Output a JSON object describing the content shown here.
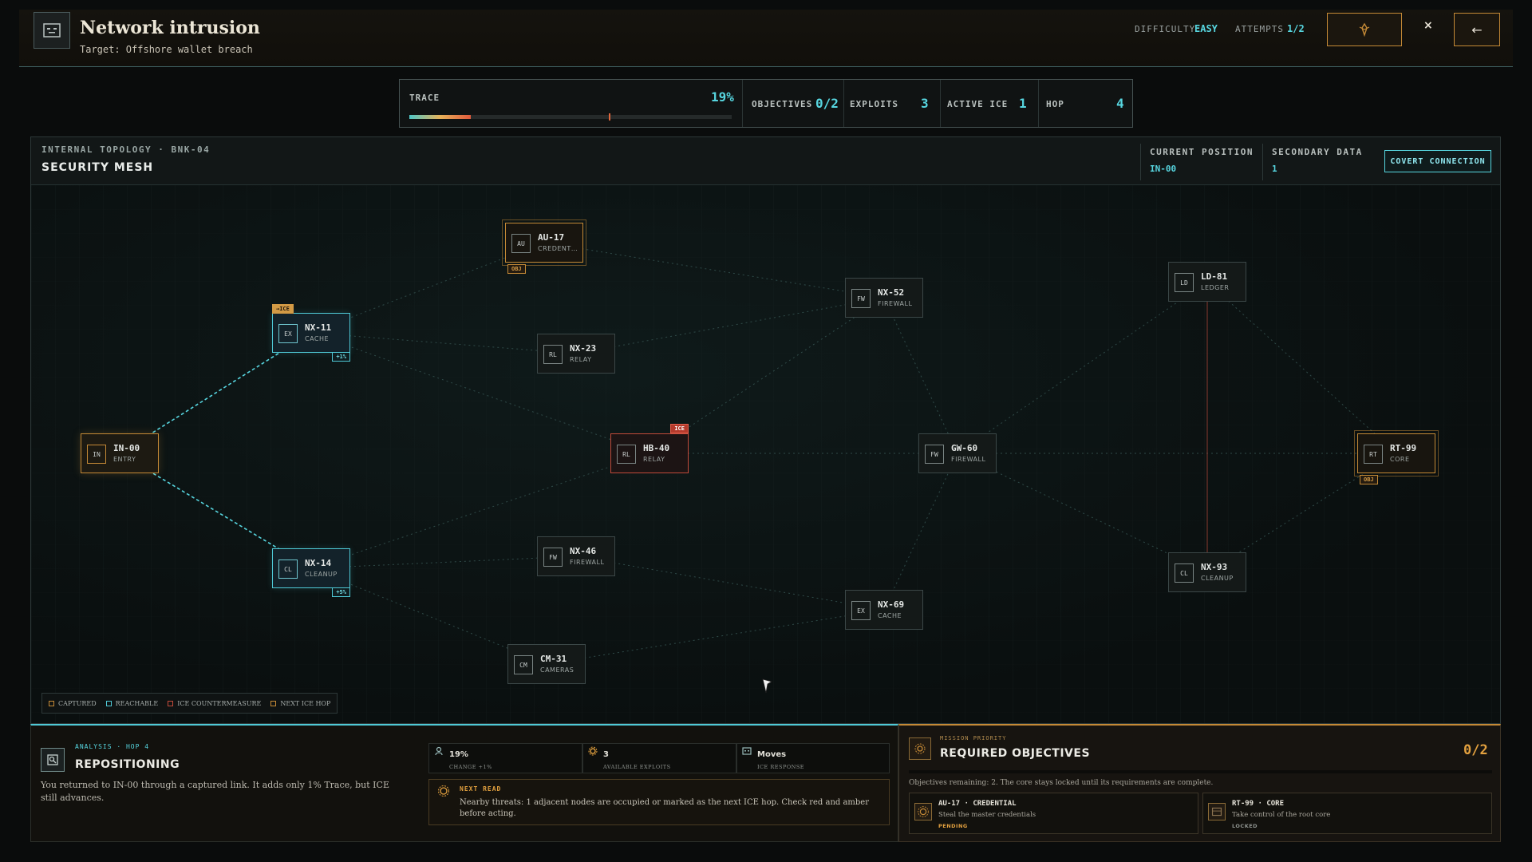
{
  "header": {
    "title": "Network intrusion",
    "subtitle": "Target: Offshore wallet breach",
    "difficulty_label": "DIFFICULTY",
    "difficulty_value": "EASY",
    "attempts_label": "ATTEMPTS",
    "attempts_value": "1/2",
    "close_symbol": "×",
    "back_symbol": "←"
  },
  "stats": {
    "trace_label": "TRACE",
    "trace_value": "19%",
    "trace_fraction": 0.19,
    "trace_threshold_fraction": 0.62,
    "objectives_label": "OBJECTIVES",
    "objectives_value": "0/2",
    "exploits_label": "EXPLOITS",
    "exploits_value": "3",
    "active_ice_label": "ACTIVE ICE",
    "active_ice_value": "1",
    "hop_label": "HOP",
    "hop_value": "4"
  },
  "topology": {
    "kicker": "INTERNAL TOPOLOGY · BNK-04",
    "title": "SECURITY MESH",
    "current_position_label": "CURRENT POSITION",
    "current_position_value": "IN-00",
    "secondary_data_label": "SECONDARY DATA",
    "secondary_data_value": "1",
    "covert_button": "COVERT CONNECTION",
    "nodes": [
      {
        "id": "IN-00",
        "icon": "IN",
        "type": "ENTRY",
        "state": "captured"
      },
      {
        "id": "NX-11",
        "icon": "EX",
        "type": "CACHE",
        "state": "reachable",
        "tag_top": "→ICE",
        "tag_bottom": "+1%"
      },
      {
        "id": "NX-14",
        "icon": "CL",
        "type": "CLEANUP",
        "state": "reachable",
        "tag_bottom": "+5%"
      },
      {
        "id": "AU-17",
        "icon": "AU",
        "type": "CREDENT…",
        "state": "obj",
        "tag_bottom": "OBJ"
      },
      {
        "id": "NX-23",
        "icon": "RL",
        "type": "RELAY",
        "state": "idle"
      },
      {
        "id": "HB-40",
        "icon": "RL",
        "type": "RELAY",
        "state": "ice",
        "tag_top": "ICE"
      },
      {
        "id": "NX-46",
        "icon": "FW",
        "type": "FIREWALL",
        "state": "idle"
      },
      {
        "id": "CM-31",
        "icon": "CM",
        "type": "CAMERAS",
        "state": "idle"
      },
      {
        "id": "NX-52",
        "icon": "FW",
        "type": "FIREWALL",
        "state": "idle"
      },
      {
        "id": "GW-60",
        "icon": "FW",
        "type": "FIREWALL",
        "state": "idle"
      },
      {
        "id": "NX-69",
        "icon": "EX",
        "type": "CACHE",
        "state": "idle"
      },
      {
        "id": "LD-81",
        "icon": "LD",
        "type": "LEDGER",
        "state": "idle"
      },
      {
        "id": "NX-93",
        "icon": "CL",
        "type": "CLEANUP",
        "state": "idle"
      },
      {
        "id": "RT-99",
        "icon": "RT",
        "type": "CORE",
        "state": "obj",
        "tag_bottom": "OBJ"
      }
    ],
    "links": [
      [
        "IN-00",
        "NX-11",
        "captured"
      ],
      [
        "IN-00",
        "NX-14",
        "captured"
      ],
      [
        "NX-11",
        "AU-17",
        "dim"
      ],
      [
        "NX-11",
        "NX-23",
        "dim"
      ],
      [
        "NX-11",
        "HB-40",
        "dim"
      ],
      [
        "NX-14",
        "HB-40",
        "dim"
      ],
      [
        "NX-14",
        "NX-46",
        "dim"
      ],
      [
        "NX-14",
        "CM-31",
        "dim"
      ],
      [
        "AU-17",
        "NX-52",
        "dim"
      ],
      [
        "NX-23",
        "NX-52",
        "dim"
      ],
      [
        "HB-40",
        "GW-60",
        "dim"
      ],
      [
        "HB-40",
        "NX-52",
        "dim"
      ],
      [
        "NX-46",
        "NX-69",
        "dim"
      ],
      [
        "CM-31",
        "NX-69",
        "dim"
      ],
      [
        "NX-52",
        "GW-60",
        "dim"
      ],
      [
        "GW-60",
        "LD-81",
        "dim"
      ],
      [
        "GW-60",
        "RT-99",
        "dim"
      ],
      [
        "GW-60",
        "NX-93",
        "dim"
      ],
      [
        "NX-69",
        "GW-60",
        "dim"
      ],
      [
        "LD-81",
        "RT-99",
        "dim"
      ],
      [
        "LD-81",
        "NX-93",
        "ice"
      ],
      [
        "NX-93",
        "RT-99",
        "dim"
      ]
    ],
    "legend": [
      {
        "label": "CAPTURED",
        "color": "#c58a36"
      },
      {
        "label": "REACHABLE",
        "color": "#4fc9d6"
      },
      {
        "label": "ICE COUNTERMEASURE",
        "color": "#c24a3a"
      },
      {
        "label": "NEXT ICE HOP",
        "color": "#c58a36"
      }
    ]
  },
  "analysis": {
    "kicker": "ANALYSIS · HOP 4",
    "title": "REPOSITIONING",
    "body": "You returned to IN-00 through a captured link. It adds only 1% Trace, but ICE still advances.",
    "mini": [
      {
        "value": "19%",
        "label": "CHANGE +1%"
      },
      {
        "value": "3",
        "label": "AVAILABLE EXPLOITS"
      },
      {
        "value": "Moves",
        "label": "ICE RESPONSE"
      }
    ],
    "next_read_kicker": "NEXT READ",
    "next_read_body": "Nearby threats: 1 adjacent nodes are occupied or marked as the next ICE hop. Check red and amber before acting."
  },
  "objectives": {
    "kicker": "MISSION PRIORITY",
    "title": "REQUIRED OBJECTIVES",
    "count": "0/2",
    "progress_fraction": 0,
    "note": "Objectives remaining: 2. The core stays locked until its requirements are complete.",
    "cards": [
      {
        "title": "AU-17 · CREDENTIAL",
        "desc": "Steal the master credentials",
        "status": "PENDING",
        "status_color": "#e3a13f"
      },
      {
        "title": "RT-99 · CORE",
        "desc": "Take control of the root core",
        "status": "LOCKED",
        "status_color": "#8d928e"
      }
    ]
  },
  "colors": {
    "accent_cyan": "#57d6e0",
    "accent_amber": "#c58a36",
    "ice_red": "#c24a3a"
  }
}
